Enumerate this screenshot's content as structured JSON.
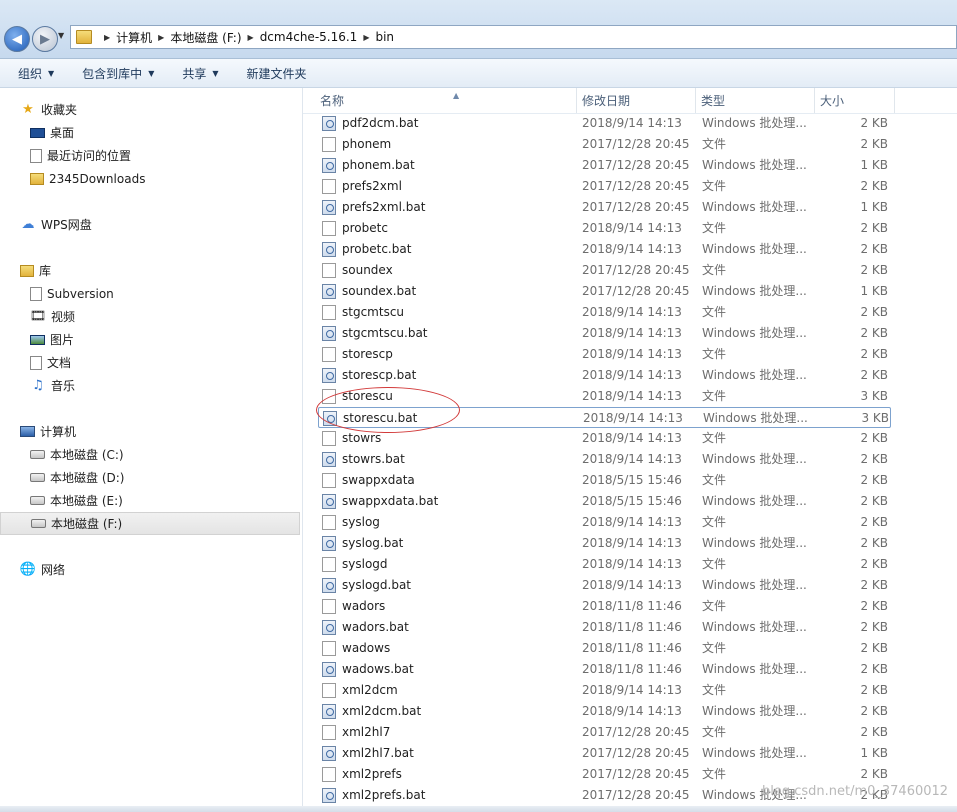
{
  "address": {
    "crumbs": [
      "计算机",
      "本地磁盘 (F:)",
      "dcm4che-5.16.1",
      "bin"
    ]
  },
  "toolbar": {
    "organize": "组织",
    "include_in_library": "包含到库中",
    "share": "共享",
    "new_folder": "新建文件夹"
  },
  "sidebar": {
    "favorites": {
      "label": "收藏夹",
      "items": [
        "桌面",
        "最近访问的位置",
        "2345Downloads"
      ]
    },
    "wps": "WPS网盘",
    "libraries": {
      "label": "库",
      "items": [
        "Subversion",
        "视频",
        "图片",
        "文档",
        "音乐"
      ]
    },
    "computer": {
      "label": "计算机",
      "items": [
        "本地磁盘 (C:)",
        "本地磁盘 (D:)",
        "本地磁盘 (E:)",
        "本地磁盘 (F:)"
      ],
      "selected": "本地磁盘 (F:)"
    },
    "network": "网络"
  },
  "columns": {
    "name": "名称",
    "date": "修改日期",
    "type": "类型",
    "size": "大小"
  },
  "files": [
    {
      "name": "pdf2dcm.bat",
      "date": "2018/9/14 14:13",
      "type": "Windows 批处理...",
      "size": "2 KB",
      "kind": "bat"
    },
    {
      "name": "phonem",
      "date": "2017/12/28 20:45",
      "type": "文件",
      "size": "2 KB",
      "kind": "file"
    },
    {
      "name": "phonem.bat",
      "date": "2017/12/28 20:45",
      "type": "Windows 批处理...",
      "size": "1 KB",
      "kind": "bat"
    },
    {
      "name": "prefs2xml",
      "date": "2017/12/28 20:45",
      "type": "文件",
      "size": "2 KB",
      "kind": "file"
    },
    {
      "name": "prefs2xml.bat",
      "date": "2017/12/28 20:45",
      "type": "Windows 批处理...",
      "size": "1 KB",
      "kind": "bat"
    },
    {
      "name": "probetc",
      "date": "2018/9/14 14:13",
      "type": "文件",
      "size": "2 KB",
      "kind": "file"
    },
    {
      "name": "probetc.bat",
      "date": "2018/9/14 14:13",
      "type": "Windows 批处理...",
      "size": "2 KB",
      "kind": "bat"
    },
    {
      "name": "soundex",
      "date": "2017/12/28 20:45",
      "type": "文件",
      "size": "2 KB",
      "kind": "file"
    },
    {
      "name": "soundex.bat",
      "date": "2017/12/28 20:45",
      "type": "Windows 批处理...",
      "size": "1 KB",
      "kind": "bat"
    },
    {
      "name": "stgcmtscu",
      "date": "2018/9/14 14:13",
      "type": "文件",
      "size": "2 KB",
      "kind": "file"
    },
    {
      "name": "stgcmtscu.bat",
      "date": "2018/9/14 14:13",
      "type": "Windows 批处理...",
      "size": "2 KB",
      "kind": "bat"
    },
    {
      "name": "storescp",
      "date": "2018/9/14 14:13",
      "type": "文件",
      "size": "2 KB",
      "kind": "file"
    },
    {
      "name": "storescp.bat",
      "date": "2018/9/14 14:13",
      "type": "Windows 批处理...",
      "size": "2 KB",
      "kind": "bat"
    },
    {
      "name": "storescu",
      "date": "2018/9/14 14:13",
      "type": "文件",
      "size": "3 KB",
      "kind": "file"
    },
    {
      "name": "storescu.bat",
      "date": "2018/9/14 14:13",
      "type": "Windows 批处理...",
      "size": "3 KB",
      "kind": "bat",
      "focused": true
    },
    {
      "name": "stowrs",
      "date": "2018/9/14 14:13",
      "type": "文件",
      "size": "2 KB",
      "kind": "file"
    },
    {
      "name": "stowrs.bat",
      "date": "2018/9/14 14:13",
      "type": "Windows 批处理...",
      "size": "2 KB",
      "kind": "bat"
    },
    {
      "name": "swappxdata",
      "date": "2018/5/15 15:46",
      "type": "文件",
      "size": "2 KB",
      "kind": "file"
    },
    {
      "name": "swappxdata.bat",
      "date": "2018/5/15 15:46",
      "type": "Windows 批处理...",
      "size": "2 KB",
      "kind": "bat"
    },
    {
      "name": "syslog",
      "date": "2018/9/14 14:13",
      "type": "文件",
      "size": "2 KB",
      "kind": "file"
    },
    {
      "name": "syslog.bat",
      "date": "2018/9/14 14:13",
      "type": "Windows 批处理...",
      "size": "2 KB",
      "kind": "bat"
    },
    {
      "name": "syslogd",
      "date": "2018/9/14 14:13",
      "type": "文件",
      "size": "2 KB",
      "kind": "file"
    },
    {
      "name": "syslogd.bat",
      "date": "2018/9/14 14:13",
      "type": "Windows 批处理...",
      "size": "2 KB",
      "kind": "bat"
    },
    {
      "name": "wadors",
      "date": "2018/11/8 11:46",
      "type": "文件",
      "size": "2 KB",
      "kind": "file"
    },
    {
      "name": "wadors.bat",
      "date": "2018/11/8 11:46",
      "type": "Windows 批处理...",
      "size": "2 KB",
      "kind": "bat"
    },
    {
      "name": "wadows",
      "date": "2018/11/8 11:46",
      "type": "文件",
      "size": "2 KB",
      "kind": "file"
    },
    {
      "name": "wadows.bat",
      "date": "2018/11/8 11:46",
      "type": "Windows 批处理...",
      "size": "2 KB",
      "kind": "bat"
    },
    {
      "name": "xml2dcm",
      "date": "2018/9/14 14:13",
      "type": "文件",
      "size": "2 KB",
      "kind": "file"
    },
    {
      "name": "xml2dcm.bat",
      "date": "2018/9/14 14:13",
      "type": "Windows 批处理...",
      "size": "2 KB",
      "kind": "bat"
    },
    {
      "name": "xml2hl7",
      "date": "2017/12/28 20:45",
      "type": "文件",
      "size": "2 KB",
      "kind": "file"
    },
    {
      "name": "xml2hl7.bat",
      "date": "2017/12/28 20:45",
      "type": "Windows 批处理...",
      "size": "1 KB",
      "kind": "bat"
    },
    {
      "name": "xml2prefs",
      "date": "2017/12/28 20:45",
      "type": "文件",
      "size": "2 KB",
      "kind": "file"
    },
    {
      "name": "xml2prefs.bat",
      "date": "2017/12/28 20:45",
      "type": "Windows 批处理...",
      "size": "2 KB",
      "kind": "bat"
    }
  ],
  "watermark": "blog.csdn.net/m0_37460012",
  "colors": {
    "annotation": "#d23a3a",
    "focus_border": "#7da2ce"
  }
}
